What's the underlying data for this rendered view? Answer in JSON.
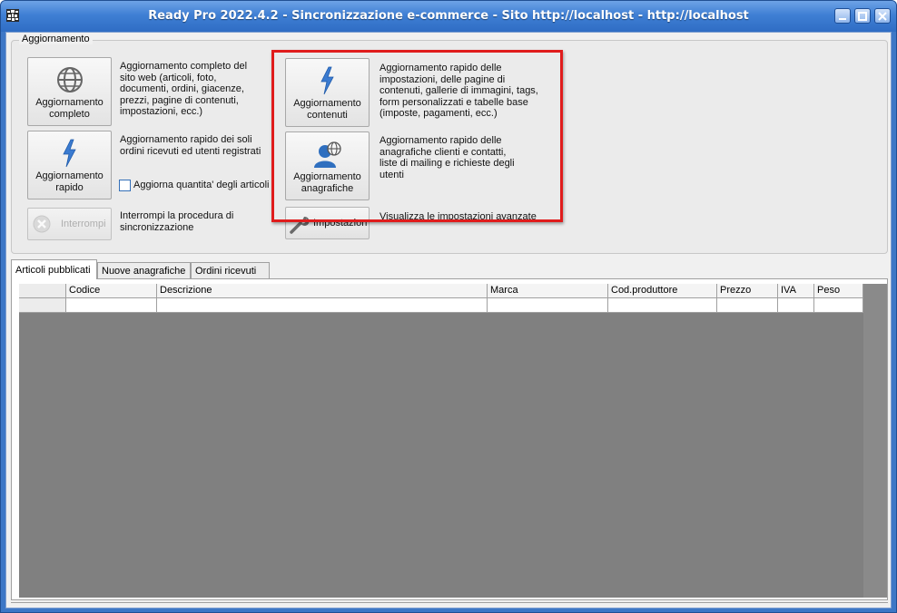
{
  "window": {
    "title": "Ready Pro 2022.4.2 - Sincronizzazione e-commerce - Sito http://localhost - http://localhost",
    "controls": [
      "minimize-icon",
      "maximize-icon",
      "close-icon"
    ]
  },
  "group": {
    "title": "Aggiornamento",
    "buttons": {
      "completo": {
        "label": "Aggiornamento completo",
        "icon": "globe-icon",
        "desc": "Aggiornamento completo del sito web (articoli, foto, documenti, ordini, giacenze, prezzi, pagine di contenuti, impostazioni, ecc.)"
      },
      "rapido": {
        "label": "Aggiornamento rapido",
        "icon": "lightning-icon",
        "desc": "Aggiornamento rapido dei soli ordini ricevuti ed utenti registrati"
      },
      "interrompi": {
        "label": "Interrompi",
        "icon": "stop-icon",
        "desc": "Interrompi la procedura di sincronizzazione"
      },
      "contenuti": {
        "label": "Aggiornamento contenuti",
        "icon": "lightning-icon",
        "desc": "Aggiornamento rapido delle impostazioni, delle pagine di contenuti, gallerie di immagini, tags, form personalizzati e tabelle base (imposte, pagamenti, ecc.)"
      },
      "anagrafiche": {
        "label": "Aggiornamento anagrafiche",
        "icon": "user-globe-icon",
        "desc": "Aggiornamento rapido delle anagrafiche clienti e contatti, liste di mailing e richieste degli utenti"
      },
      "impostazioni": {
        "label": "Impostazion",
        "icon": "wrench-icon",
        "desc": "Visualizza le impostazioni avanzate"
      }
    },
    "checkbox": {
      "label": "Aggiorna quantita' degli articoli",
      "checked": false
    }
  },
  "tabs": [
    {
      "label": "Articoli pubblicati",
      "active": true
    },
    {
      "label": "Nuove anagrafiche",
      "active": false
    },
    {
      "label": "Ordini ricevuti",
      "active": false
    }
  ],
  "grid": {
    "columns": [
      "Codice",
      "Descrizione",
      "Marca",
      "Cod.produttore",
      "Prezzo",
      "IVA",
      "Peso"
    ],
    "rows": [
      [
        "",
        "",
        "",
        "",
        "",
        "",
        ""
      ]
    ]
  },
  "colors": {
    "highlight": "#e01c1c",
    "titlebar": "#3f7fd4",
    "grid_background": "#808080"
  }
}
